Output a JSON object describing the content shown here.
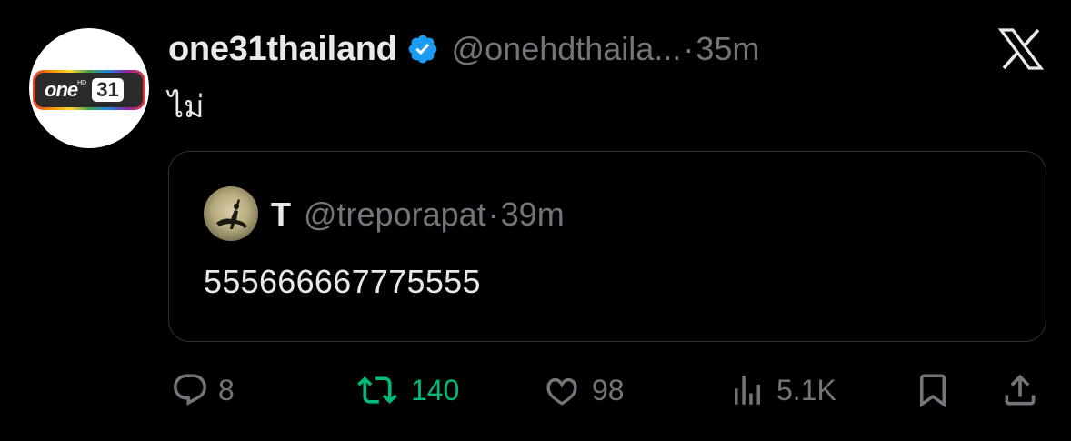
{
  "tweet": {
    "display_name": "one31thailand",
    "handle": "@onehdthaila...",
    "separator": "·",
    "time": "35m",
    "text": "ไม่",
    "avatar_logo": {
      "word": "one",
      "hd": "HD",
      "number": "31"
    }
  },
  "quoted": {
    "display_name": "T",
    "handle": "@treporapat",
    "separator": "·",
    "time": "39m",
    "text": "555666667775555"
  },
  "actions": {
    "replies": "8",
    "retweets": "140",
    "likes": "98",
    "views": "5.1K"
  },
  "colors": {
    "background": "#000000",
    "primary_text": "#e7e9ea",
    "secondary_text": "#71767b",
    "verified": "#1d9bf0",
    "retweet_active": "#00ba7c",
    "border": "#2f3336"
  },
  "icons": [
    "verified-badge-icon",
    "x-logo-icon",
    "reply-icon",
    "retweet-icon",
    "like-icon",
    "views-icon",
    "bookmark-icon",
    "share-icon"
  ]
}
